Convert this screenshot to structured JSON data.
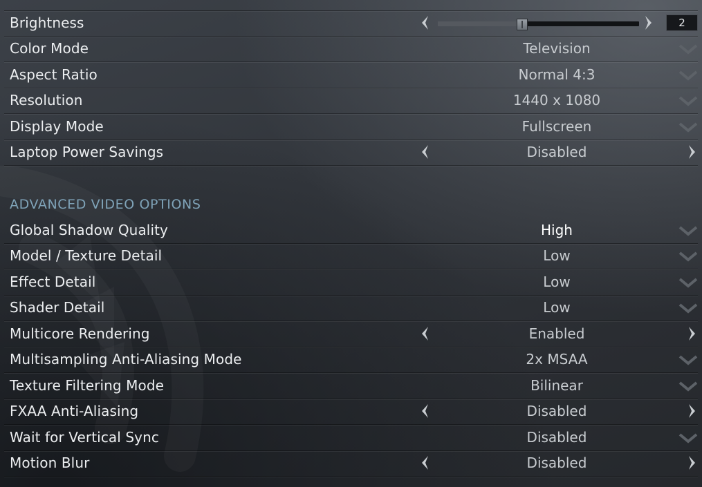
{
  "settings": [
    {
      "label": "Brightness",
      "control": "slider"
    },
    {
      "label": "Color Mode",
      "value": "Television",
      "control": "dropdown"
    },
    {
      "label": "Aspect Ratio",
      "value": "Normal 4:3",
      "control": "dropdown"
    },
    {
      "label": "Resolution",
      "value": "1440 x 1080",
      "control": "dropdown"
    },
    {
      "label": "Display Mode",
      "value": "Fullscreen",
      "control": "dropdown"
    },
    {
      "label": "Laptop Power Savings",
      "value": "Disabled",
      "control": "toggle"
    }
  ],
  "brightness": {
    "value": "2",
    "level": 0.42
  },
  "advanced": {
    "title": "ADVANCED VIDEO OPTIONS",
    "settings": [
      {
        "label": "Global Shadow Quality",
        "value": "High",
        "control": "dropdown"
      },
      {
        "label": "Model / Texture Detail",
        "value": "Low",
        "control": "dropdown"
      },
      {
        "label": "Effect Detail",
        "value": "Low",
        "control": "dropdown"
      },
      {
        "label": "Shader Detail",
        "value": "Low",
        "control": "dropdown"
      },
      {
        "label": "Multicore Rendering",
        "value": "Enabled",
        "control": "toggle"
      },
      {
        "label": "Multisampling Anti-Aliasing Mode",
        "value": "2x MSAA",
        "control": "dropdown"
      },
      {
        "label": "Texture Filtering Mode",
        "value": "Bilinear",
        "control": "dropdown"
      },
      {
        "label": "FXAA Anti-Aliasing",
        "value": "Disabled",
        "control": "toggle"
      },
      {
        "label": "Wait for Vertical Sync",
        "value": "Disabled",
        "control": "dropdown"
      },
      {
        "label": "Motion Blur",
        "value": "Disabled",
        "control": "toggle"
      }
    ]
  },
  "icons": {
    "dropdown": "chevron-down-icon",
    "prev": "arrow-left-icon",
    "next": "arrow-right-icon"
  },
  "colors": {
    "section_title": "#7fa3b8",
    "background": "#32363c"
  }
}
